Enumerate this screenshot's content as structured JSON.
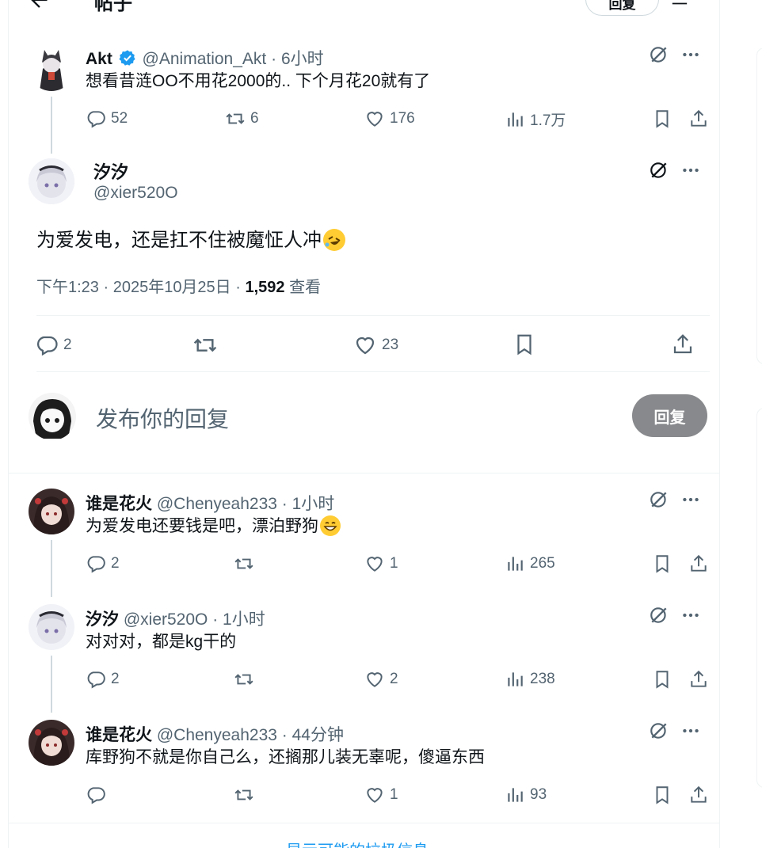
{
  "header": {
    "title": "帖子",
    "reply_button": "回复"
  },
  "parent_post": {
    "name": "Akt",
    "handle": "@Animation_Akt",
    "time": "6小时",
    "text": "想看昔涟OO不用花2000的.. 下个月花20就有了",
    "replies": "52",
    "reposts": "6",
    "likes": "176",
    "views": "1.7万"
  },
  "main_post": {
    "name": "汐汐",
    "handle": "@xier520O",
    "text": "为爱发电，还是扛不住被魔怔人冲",
    "timestamp": "下午1:23 · 2025年10月25日 · ",
    "views_count": "1,592",
    "views_label": " 查看",
    "replies": "2",
    "likes": "23"
  },
  "compose": {
    "placeholder": "发布你的回复",
    "button": "回复"
  },
  "replies": [
    {
      "name": "谁是花火",
      "handle": "@Chenyeah233",
      "time": "1小时",
      "text": "为爱发电还要钱是吧，漂泊野狗",
      "replies": "2",
      "reposts": "",
      "likes": "1",
      "views": "265"
    },
    {
      "name": "汐汐",
      "handle": "@xier520O",
      "time": "1小时",
      "text": "对对对，都是kg干的",
      "replies": "2",
      "reposts": "",
      "likes": "2",
      "views": "238"
    },
    {
      "name": "谁是花火",
      "handle": "@Chenyeah233",
      "time": "44分钟",
      "text": "库野狗不就是你自己么，还搁那儿装无辜呢，傻逼东西",
      "replies": "",
      "reposts": "",
      "likes": "1",
      "views": "93"
    }
  ],
  "footer_link": "显示可能的垃圾信息",
  "colors": {
    "accent": "#1d9bf0",
    "muted": "#536471",
    "text": "#0f1419",
    "disabled_button": "#87898c"
  }
}
